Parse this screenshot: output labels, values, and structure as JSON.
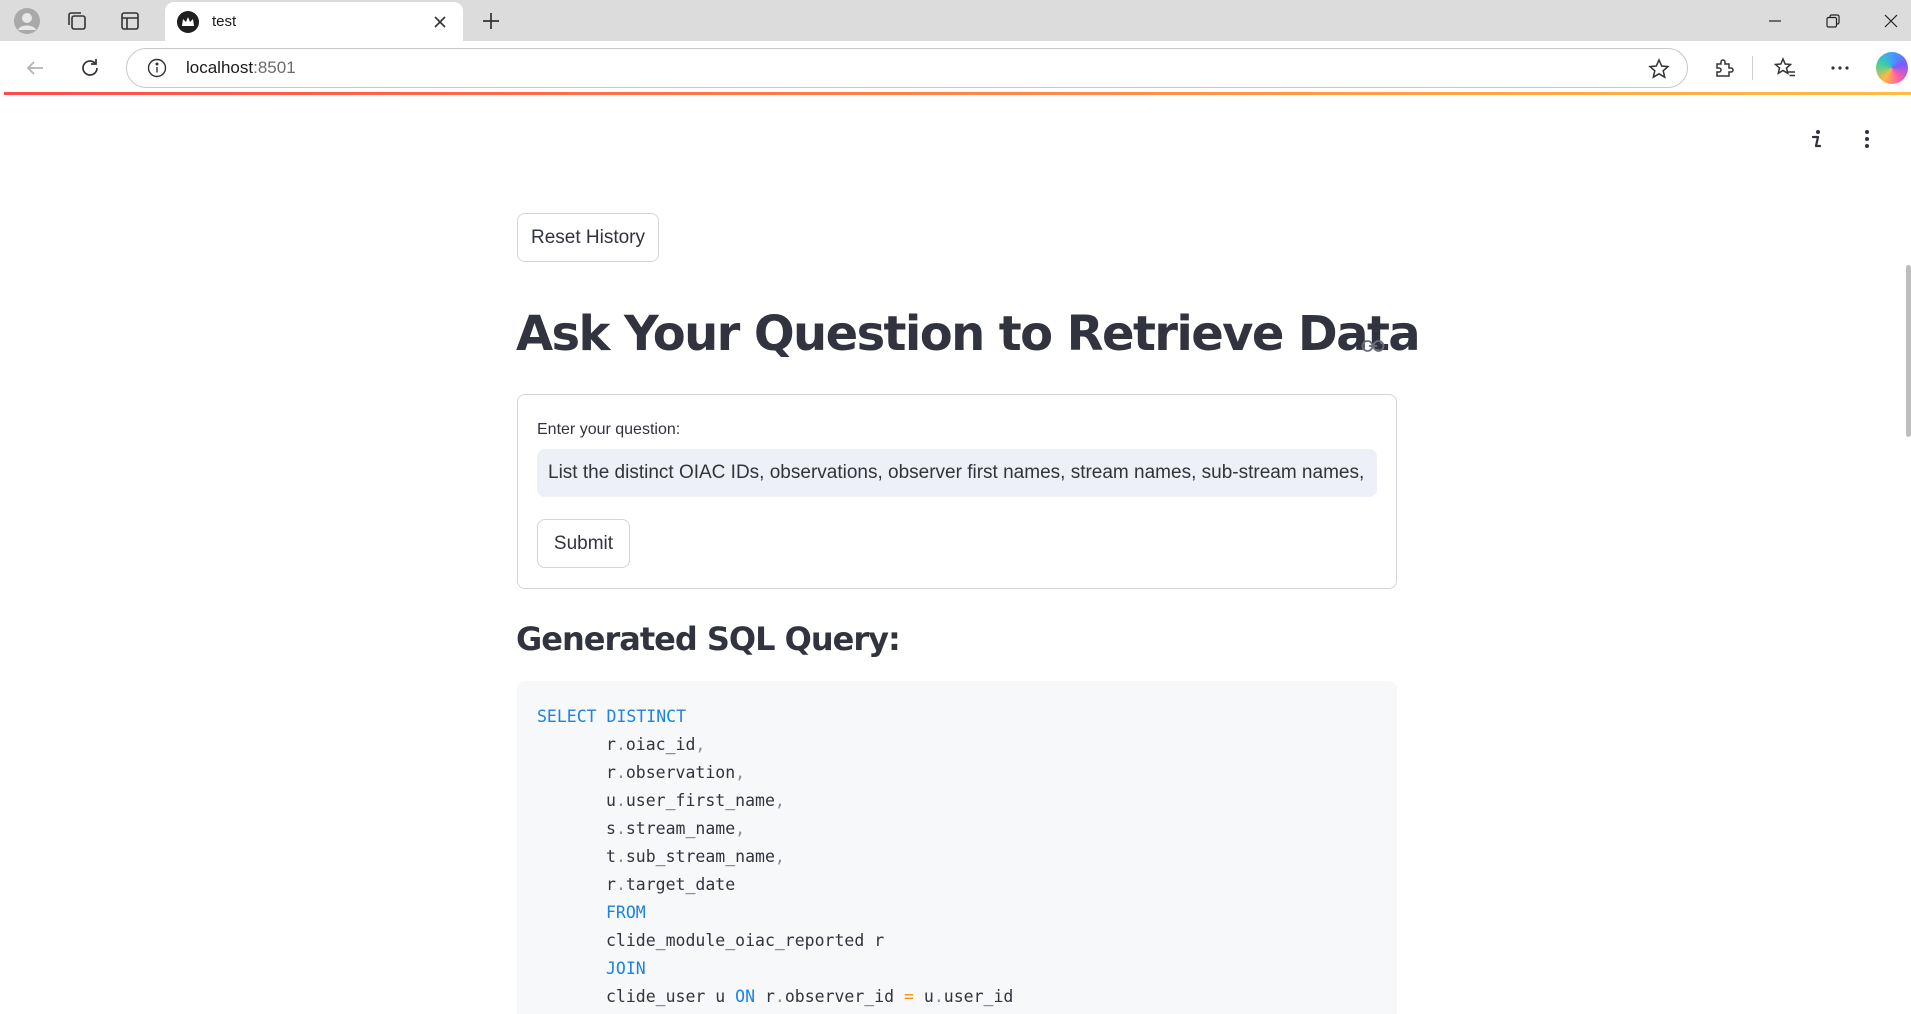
{
  "browser": {
    "tab_title": "test",
    "address_host": "localhost",
    "address_port": ":8501"
  },
  "app": {
    "reset_button_label": "Reset History",
    "title": "Ask Your Question to Retrieve Data",
    "question_label": "Enter your question:",
    "question_value": "List the distinct OIAC IDs, observations, observer first names, stream names, sub-stream names, an",
    "submit_button_label": "Submit",
    "sql_heading": "Generated SQL Query:",
    "sql_lines": [
      "SELECT DISTINCT",
      "r.oiac_id,",
      "r.observation,",
      "u.user_first_name,",
      "s.stream_name,",
      "t.sub_stream_name,",
      "r.target_date",
      "FROM",
      "clide_module_oiac_reported r",
      "JOIN",
      "clide_user u ON r.observer_id = u.user_id"
    ]
  },
  "colors": {
    "accent_gradient_start": "#ff4b4b",
    "accent_gradient_end": "#ffbd45",
    "sql_keyword": "#1c83e1",
    "sql_operator": "#ff8c00",
    "text": "#31333f"
  },
  "icons": {
    "profile": "profile-icon",
    "workspaces": "workspaces-icon",
    "tab_actions": "tab-actions-icon",
    "favicon": "streamlit-crown-icon",
    "close": "close-icon",
    "new_tab": "plus-icon",
    "minimize": "minimize-icon",
    "restore": "restore-icon",
    "back": "back-arrow-icon",
    "reload": "reload-icon",
    "site_info": "info-icon",
    "favorite": "star-icon",
    "extensions": "puzzle-icon",
    "favorites": "favorites-icon",
    "more": "more-horizontal-icon",
    "copilot": "copilot-icon",
    "app_info": "info-italic-icon",
    "app_menu": "kebab-menu-icon",
    "heading_link": "link-icon"
  }
}
